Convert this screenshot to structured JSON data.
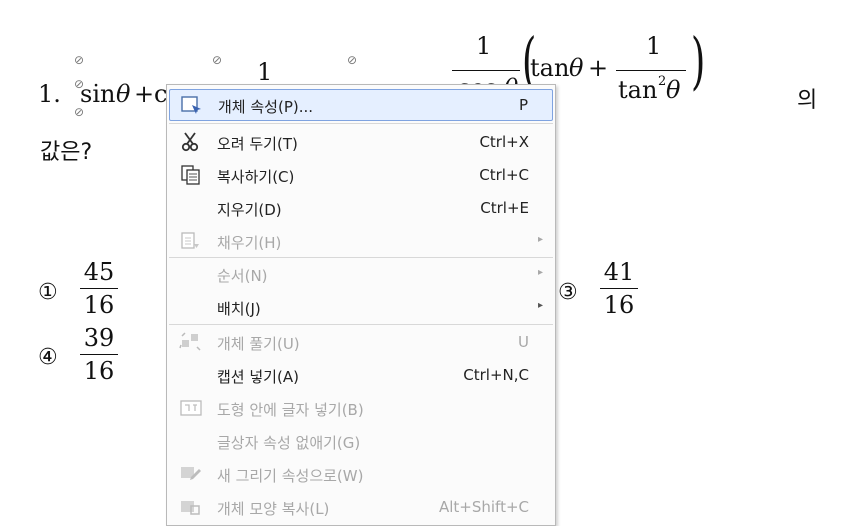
{
  "question": {
    "number": "1.",
    "tail": "의",
    "line2": "값은?",
    "expr_sin": "sin",
    "expr_theta": "θ",
    "expr_plus": "+",
    "expr_partial": "c",
    "frac_top_num": "1",
    "frac_right_num": "1",
    "frac_right_den_partial": "cos θ",
    "inner_tan": "tan",
    "inner_theta": "θ",
    "inner_plus": "+",
    "inner_frac_num": "1",
    "inner_frac_den_tan": "tan",
    "inner_frac_den_exp": "2",
    "inner_frac_den_theta": "θ",
    "selection_handle": "⊘"
  },
  "choices": [
    {
      "mark": "①",
      "num": "45",
      "den": "16"
    },
    {
      "mark": "③",
      "num": "41",
      "den": "16"
    },
    {
      "mark": "④",
      "num": "39",
      "den": "16"
    }
  ],
  "context_menu": {
    "items": [
      {
        "label": "개체 속성(P)...",
        "key": "P",
        "icon": "object-properties-icon",
        "enabled": true,
        "selected": true
      },
      {
        "label": "오려 두기(T)",
        "key": "Ctrl+X",
        "icon": "scissors-icon",
        "enabled": true
      },
      {
        "label": "복사하기(C)",
        "key": "Ctrl+C",
        "icon": "copy-icon",
        "enabled": true
      },
      {
        "label": "지우기(D)",
        "key": "Ctrl+E",
        "icon": "",
        "enabled": true
      },
      {
        "label": "채우기(H)",
        "key": "",
        "icon": "fill-icon",
        "enabled": false,
        "submenu": true
      },
      {
        "label": "순서(N)",
        "key": "",
        "icon": "",
        "enabled": false,
        "submenu": true
      },
      {
        "label": "배치(J)",
        "key": "",
        "icon": "",
        "enabled": true,
        "submenu": true
      },
      {
        "label": "개체 풀기(U)",
        "key": "U",
        "icon": "ungroup-icon",
        "enabled": false
      },
      {
        "label": "캡션 넣기(A)",
        "key": "Ctrl+N,C",
        "icon": "",
        "enabled": true
      },
      {
        "label": "도형 안에 글자 넣기(B)",
        "key": "",
        "icon": "text-in-shape-icon",
        "enabled": false
      },
      {
        "label": "글상자 속성 없애기(G)",
        "key": "",
        "icon": "",
        "enabled": false
      },
      {
        "label": "새 그리기 속성으로(W)",
        "key": "",
        "icon": "new-drawing-style-icon",
        "enabled": false
      },
      {
        "label": "개체 모양 복사(L)",
        "key": "Alt+Shift+C",
        "icon": "copy-shape-icon",
        "enabled": false
      }
    ],
    "submenu_arrow": "▸",
    "colors": {
      "highlight": "#e5efff",
      "highlight_border": "#7fa3e0",
      "disabled": "#a8a8a8"
    }
  }
}
